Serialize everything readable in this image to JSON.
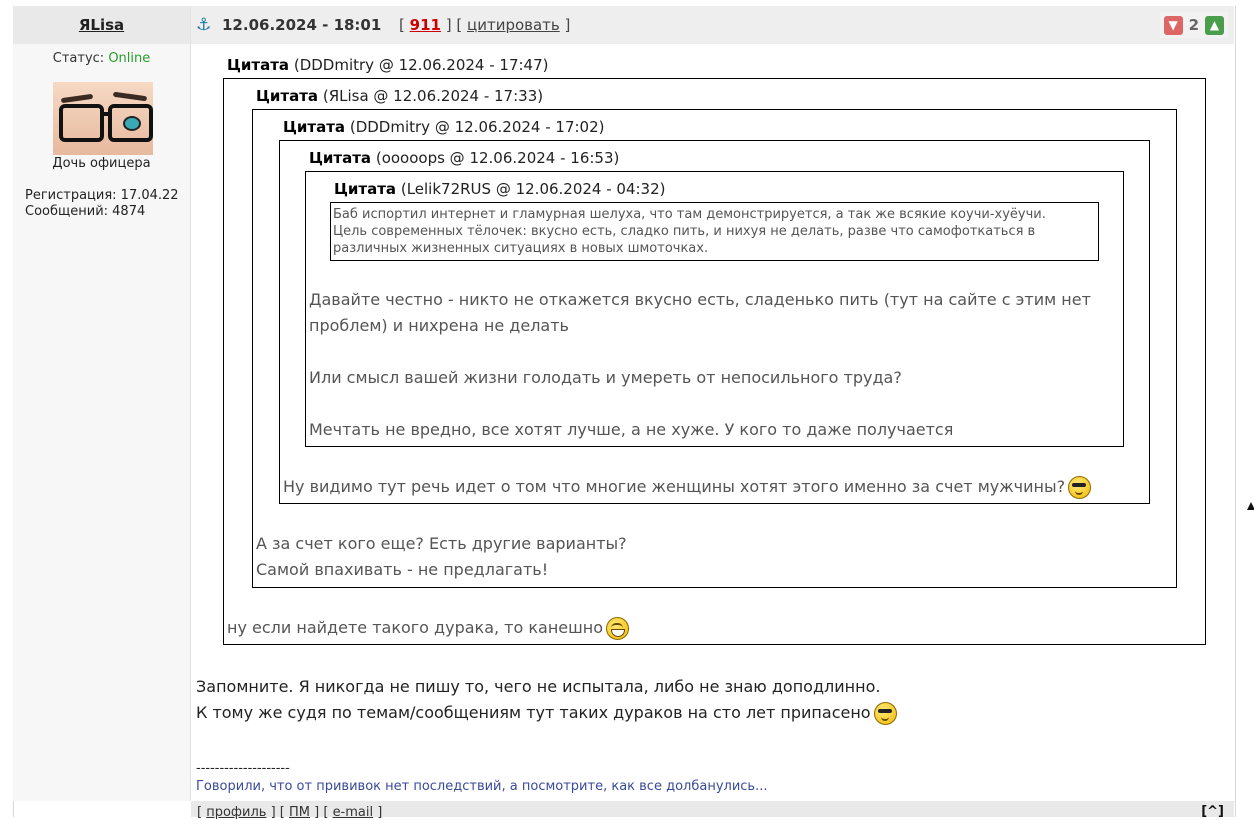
{
  "user": {
    "name": "ЯLisa",
    "status_label": "Статус:",
    "status_value": "Online",
    "title": "Дочь офицера",
    "registration": "Регистрация: 17.04.22",
    "messages": "Сообщений: 4874"
  },
  "post": {
    "datetime": "12.06.2024 - 18:01",
    "meta_open": "[",
    "number": "911",
    "meta_mid": "] [",
    "cite_label": "цитировать",
    "meta_close": "]",
    "rating": "2"
  },
  "quotes": {
    "q1_label": "Цитата",
    "q1_src": "(DDDmitry @ 12.06.2024 - 17:47)",
    "q2_label": "Цитата",
    "q2_src": "(ЯLisa @ 12.06.2024 - 17:33)",
    "q3_label": "Цитата",
    "q3_src": "(DDDmitry @ 12.06.2024 - 17:02)",
    "q4_label": "Цитата",
    "q4_src": "(ooooops @ 12.06.2024 - 16:53)",
    "q5_label": "Цитата",
    "q5_src": "(Lelik72RUS @ 12.06.2024 - 04:32)",
    "innermost_line1": "Баб испортил интернет и гламурная шелуха, что там демонстрируется, а так же всякие коучи-хуёучи.",
    "innermost_line2": "Цель современных тёлочек: вкусно есть, сладко пить,  и нихуя не делать, разве что самофоткаться в",
    "innermost_line3": "различных жизненных ситуациях в новых шмоточках.",
    "q4_line1": "Давайте честно - никто не откажется вкусно есть, сладенько пить (тут на сайте с этим нет",
    "q4_line2": "проблем) и нихрена не делать",
    "q4_line3": "Или смысл вашей жизни голодать и умереть от непосильного труда?",
    "q4_line4": "Мечтать не вредно, все хотят лучше, а не хуже. У кого то даже получается",
    "q3_text": "Ну видимо тут речь идет о том что многие женщины хотят этого именно за счет мужчины?",
    "q2_line1": "А за счет кого еще? Есть другие варианты?",
    "q2_line2": "Самой впахивать - не предлагать!",
    "q1_text": "ну если найдете такого дурака, то канешно"
  },
  "body": {
    "line1": "Запомните. Я никогда не пишу то, чего не испытала, либо не знаю доподлинно.",
    "line2": "К тому же судя по темам/сообщениям тут таких дураков на сто лет припасено"
  },
  "signature": {
    "separator": "--------------------",
    "text": "Говорили, что от прививок нет последствий, а посмотрите, как все долбанулись..."
  },
  "footer": {
    "b1": "[ ",
    "profile": "профиль",
    "b2": " ] [ ",
    "pm": "ПМ",
    "b3": " ] [ ",
    "email": "e-mail",
    "b4": " ]",
    "top": "[^]"
  },
  "colors": {
    "online": "#2a9d2a",
    "post_number": "#cc0000",
    "signature": "#3a4a9a"
  },
  "icons": [
    "anchor-icon",
    "thumb-down-icon",
    "thumb-up-icon",
    "cool-smiley-icon",
    "laugh-smiley-icon"
  ]
}
